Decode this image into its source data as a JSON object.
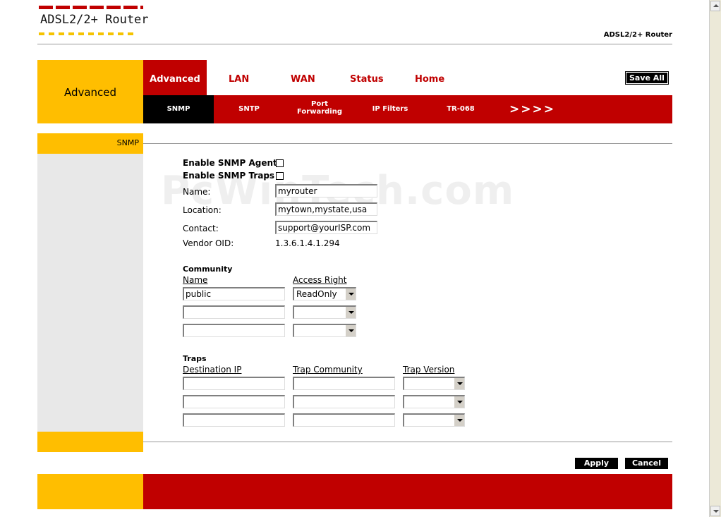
{
  "header": {
    "logo": "ADSL2/2+ Router",
    "brand_right": "ADSL2/2+ Router"
  },
  "nav": {
    "section": "Advanced",
    "tabs": [
      "Advanced",
      "LAN",
      "WAN",
      "Status",
      "Home"
    ],
    "save_all": "Save All",
    "subtabs": {
      "snmp": "SNMP",
      "sntp": "SNTP",
      "port_line1": "Port",
      "port_line2": "Forwarding",
      "ipfilters": "IP Filters",
      "tr068": "TR-068",
      "more": ">>>>"
    }
  },
  "sidebar": {
    "current": "SNMP"
  },
  "watermark": "PcWinTech.com",
  "form": {
    "enable_agent": "Enable SNMP Agent",
    "enable_traps": "Enable SNMP Traps",
    "name_label": "Name:",
    "name_value": "myrouter",
    "location_label": "Location:",
    "location_value": "mytown,mystate,usa",
    "contact_label": "Contact:",
    "contact_value": "support@yourISP.com",
    "vendor_label": "Vendor OID:",
    "vendor_value": "1.3.6.1.4.1.294"
  },
  "community": {
    "title": "Community",
    "col_name": "Name",
    "col_access": "Access Right",
    "rows": [
      {
        "name": "public",
        "access": "ReadOnly"
      },
      {
        "name": "",
        "access": ""
      },
      {
        "name": "",
        "access": ""
      }
    ]
  },
  "traps": {
    "title": "Traps",
    "col_ip": "Destination IP",
    "col_community": "Trap Community",
    "col_version": "Trap Version"
  },
  "actions": {
    "apply": "Apply",
    "cancel": "Cancel"
  }
}
